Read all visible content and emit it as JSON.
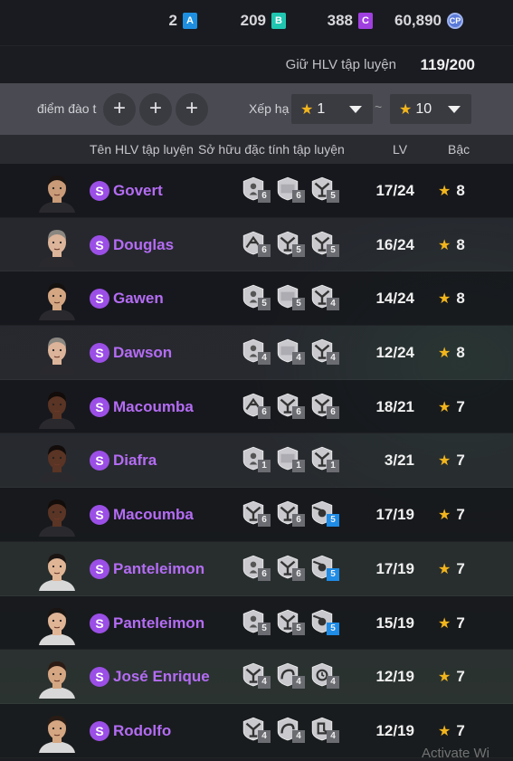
{
  "currency": {
    "a": {
      "value": "2",
      "icon": "A"
    },
    "b": {
      "value": "209",
      "icon": "B"
    },
    "c": {
      "value": "388",
      "icon": "C"
    },
    "cp": {
      "value": "60,890",
      "icon": "CP"
    }
  },
  "coach_count": {
    "label": "Giữ HLV tập luyện",
    "value": "119/200"
  },
  "filters": {
    "score_label": "điểm đào t",
    "add_symbol": "+",
    "rank_label": "Xếp hạ",
    "rank_from": "1",
    "rank_to": "10",
    "separator": "~"
  },
  "columns": {
    "name": "Tên HLV tập luyện",
    "traits": "Sở hữu đặc tính tập luyện",
    "lv": "LV",
    "tier": "Bậc"
  },
  "coaches": [
    {
      "name": "Govert",
      "badge": "S",
      "lv": "17/24",
      "tier": "8",
      "traits": [
        {
          "icon": "shield-person-icon",
          "level": "6"
        },
        {
          "icon": "shield-flat-icon",
          "level": "6"
        },
        {
          "icon": "shield-figure-icon",
          "level": "5"
        }
      ],
      "skin": "#c99b78",
      "hair": "#1a1412",
      "shirt": "#2a2a2e"
    },
    {
      "name": "Douglas",
      "badge": "S",
      "lv": "16/24",
      "tier": "8",
      "traits": [
        {
          "icon": "shield-arrows-icon",
          "level": "6"
        },
        {
          "icon": "shield-figure-icon",
          "level": "5"
        },
        {
          "icon": "shield-figure-icon",
          "level": "5"
        }
      ],
      "skin": "#dcb49a",
      "hair": "#8a8680",
      "shirt": "#2a2a2e"
    },
    {
      "name": "Gawen",
      "badge": "S",
      "lv": "14/24",
      "tier": "8",
      "traits": [
        {
          "icon": "shield-person-icon",
          "level": "5"
        },
        {
          "icon": "shield-flat-icon",
          "level": "5"
        },
        {
          "icon": "shield-figure-icon",
          "level": "4"
        }
      ],
      "skin": "#d4a682",
      "hair": "#15110f",
      "shirt": "#2a2a2e"
    },
    {
      "name": "Dawson",
      "badge": "S",
      "lv": "12/24",
      "tier": "8",
      "traits": [
        {
          "icon": "shield-person-icon",
          "level": "4"
        },
        {
          "icon": "shield-flat-icon",
          "level": "4"
        },
        {
          "icon": "shield-figure-icon",
          "level": "4"
        }
      ],
      "skin": "#dcb49a",
      "hair": "#8a8680",
      "shirt": "#2a2a2e"
    },
    {
      "name": "Macoumba",
      "badge": "S",
      "lv": "18/21",
      "tier": "7",
      "traits": [
        {
          "icon": "shield-arrows-icon",
          "level": "6"
        },
        {
          "icon": "shield-figure-icon",
          "level": "6"
        },
        {
          "icon": "shield-figure-icon",
          "level": "6"
        }
      ],
      "skin": "#5a3424",
      "hair": "#120c0a",
      "shirt": "#2a2a2e"
    },
    {
      "name": "Diafra",
      "badge": "S",
      "lv": "3/21",
      "tier": "7",
      "traits": [
        {
          "icon": "shield-person-icon",
          "level": "1"
        },
        {
          "icon": "shield-flat-icon",
          "level": "1"
        },
        {
          "icon": "shield-figure-icon",
          "level": "1"
        }
      ],
      "skin": "#5a3424",
      "hair": "#120c0a",
      "shirt": "#2a2a2e"
    },
    {
      "name": "Macoumba",
      "badge": "S",
      "lv": "17/19",
      "tier": "7",
      "traits": [
        {
          "icon": "shield-figure-icon",
          "level": "6"
        },
        {
          "icon": "shield-figure-icon",
          "level": "6"
        },
        {
          "icon": "shield-ball-icon",
          "level": "5",
          "highlight": true
        }
      ],
      "skin": "#5a3424",
      "hair": "#120c0a",
      "shirt": "#2a2a2e"
    },
    {
      "name": "Panteleimon",
      "badge": "S",
      "lv": "17/19",
      "tier": "7",
      "traits": [
        {
          "icon": "shield-person-icon",
          "level": "6"
        },
        {
          "icon": "shield-figure-icon",
          "level": "6"
        },
        {
          "icon": "shield-ball-icon",
          "level": "5",
          "highlight": true
        }
      ],
      "skin": "#e0b596",
      "hair": "#1a1412",
      "shirt": "#d8d8d8"
    },
    {
      "name": "Panteleimon",
      "badge": "S",
      "lv": "15/19",
      "tier": "7",
      "traits": [
        {
          "icon": "shield-person-icon",
          "level": "5"
        },
        {
          "icon": "shield-figure-icon",
          "level": "5"
        },
        {
          "icon": "shield-ball-icon",
          "level": "5",
          "highlight": true
        }
      ],
      "skin": "#e0b596",
      "hair": "#1a1412",
      "shirt": "#d8d8d8"
    },
    {
      "name": "José Enrique",
      "badge": "S",
      "lv": "12/19",
      "tier": "7",
      "traits": [
        {
          "icon": "shield-figure-icon",
          "level": "4"
        },
        {
          "icon": "shield-curve-icon",
          "level": "4"
        },
        {
          "icon": "shield-clock-icon",
          "level": "4"
        }
      ],
      "skin": "#d4a682",
      "hair": "#2a1c14",
      "shirt": "#d8d8d8"
    },
    {
      "name": "Rodolfo",
      "badge": "S",
      "lv": "12/19",
      "tier": "7",
      "traits": [
        {
          "icon": "shield-figure-icon",
          "level": "4"
        },
        {
          "icon": "shield-curve-icon",
          "level": "4"
        },
        {
          "icon": "shield-boot-icon",
          "level": "4"
        }
      ],
      "skin": "#d4a682",
      "hair": "#2a1c14",
      "shirt": "#d8d8d8"
    }
  ],
  "watermark": "Activate Wi",
  "colors": {
    "accent_purple": "#b46cf4",
    "star": "#f2b51c",
    "highlight_blue": "#1f8ce6"
  }
}
